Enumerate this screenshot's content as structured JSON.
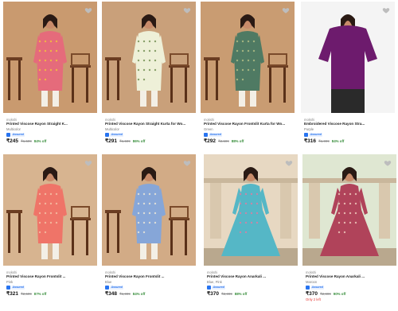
{
  "products": [
    {
      "brand": "mokshi",
      "title": "Printed Viscose Rayon Straight K...",
      "color": "Multicolor",
      "assured_label": "Assured",
      "price": "₹245",
      "mrp": "₹1,599",
      "discount": "84% off",
      "stock": "",
      "bg": "#c99a6f",
      "dress": "#e56b7b",
      "accent": "#f2c63b"
    },
    {
      "brand": "mokshi",
      "title": "Printed Viscose Rayon Straight Kurta for Wo...",
      "color": "Multicolor",
      "assured_label": "Assured",
      "price": "₹291",
      "mrp": "₹1,599",
      "discount": "86% off",
      "stock": "",
      "bg": "#c9a07a",
      "dress": "#eef0d8",
      "accent": "#6f8c4e"
    },
    {
      "brand": "mokshi",
      "title": "Printed Viscose Rayon Frontslit Kurta for Wo...",
      "color": "Green",
      "assured_label": "Assured",
      "price": "₹292",
      "mrp": "₹2,599",
      "discount": "88% off",
      "stock": "",
      "bg": "#c99c72",
      "dress": "#4f7a63",
      "accent": "#b6c287"
    },
    {
      "brand": "mokshi",
      "title": "Embroidered Viscose Rayon Stra...",
      "color": "Purple",
      "assured_label": "Assured",
      "price": "₹316",
      "mrp": "₹1,999",
      "discount": "84% off",
      "stock": "",
      "bg": "#f4f4f4",
      "dress": "#6d1b6d",
      "accent": "#3a3a3a"
    },
    {
      "brand": "mokshi",
      "title": "Printed Viscose Rayon Frontslit ...",
      "color": "Pink",
      "assured_label": "Assured",
      "price": "₹321",
      "mrp": "₹2,599",
      "discount": "87% off",
      "stock": "",
      "bg": "#d7b490",
      "dress": "#ef7468",
      "accent": "#f4c4a8"
    },
    {
      "brand": "mokshi",
      "title": "Printed Viscose Rayon Frontslit ...",
      "color": "Blue",
      "assured_label": "Assured",
      "price": "₹348",
      "mrp": "₹1,999",
      "discount": "84% off",
      "stock": "",
      "bg": "#d2ab86",
      "dress": "#86a6d8",
      "accent": "#f0ead8"
    },
    {
      "brand": "mokshi",
      "title": "Printed Viscose Rayon Anarkali ...",
      "color": "Blue, Pink",
      "assured_label": "Assured",
      "price": "₹370",
      "mrp": "₹2,999",
      "discount": "88% off",
      "stock": "",
      "bg": "#e7d8c2",
      "dress": "#55b7c6",
      "accent": "#e17aa0"
    },
    {
      "brand": "mokshi",
      "title": "Printed Viscose Rayon Anarkali ...",
      "color": "Maroon",
      "assured_label": "Assured",
      "price": "₹370",
      "mrp": "₹2,999",
      "discount": "90% off",
      "stock": "Only 2 left",
      "bg": "#dfe7d2",
      "dress": "#b0435a",
      "accent": "#f1d0c0"
    }
  ],
  "colors": {
    "wishlist": "#bdbdbd",
    "assured": "#2874f0",
    "discount": "#388e3c",
    "stock_warning": "#e53935"
  },
  "icons": {
    "wishlist": "heart-icon",
    "assured": "assured-badge-icon"
  }
}
